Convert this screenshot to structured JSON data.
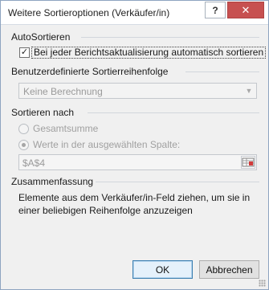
{
  "window": {
    "title": "Weitere Sortieroptionen (Verkäufer/in)",
    "help_label": "?",
    "close_label": "✕"
  },
  "autosort": {
    "section_label": "AutoSortieren",
    "checkbox_label": "Bei jeder Berichtsaktualisierung automatisch sortieren",
    "checked": true
  },
  "custom_order": {
    "section_label": "Benutzerdefinierte Sortierreihenfolge",
    "selected_value": "Keine Berechnung"
  },
  "sort_by": {
    "section_label": "Sortieren nach",
    "options": [
      {
        "label": "Gesamtsumme",
        "selected": false
      },
      {
        "label": "Werte in der ausgewählten Spalte:",
        "selected": true
      }
    ],
    "reference_value": "$A$4"
  },
  "summary": {
    "section_label": "Zusammenfassung",
    "text": "Elemente aus dem Verkäufer/in-Feld ziehen, um sie in einer beliebigen Reihenfolge anzuzeigen"
  },
  "buttons": {
    "ok_label": "OK",
    "cancel_label": "Abbrechen"
  },
  "colors": {
    "close_button": "#c75050",
    "dialog_background": "#f0f0f0",
    "ok_border": "#3c7fb1"
  }
}
